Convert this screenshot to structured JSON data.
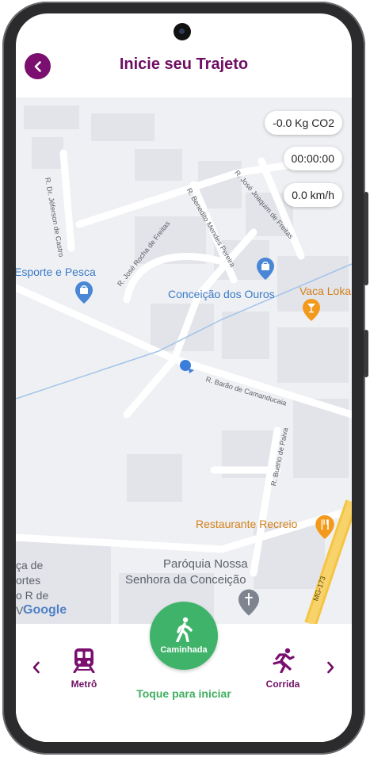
{
  "header": {
    "title": "Inicie seu Trajeto"
  },
  "stats": {
    "co2": "-0.0 Kg CO2",
    "time": "00:00:00",
    "speed": "0.0 km/h"
  },
  "map": {
    "places": {
      "esporte": "Esporte e Pesca",
      "conceicao": "Conceição dos Ouros",
      "vaca": "Vaca Loka",
      "restaurante": "Restaurante Recreio",
      "paroquia_l1": "Paróquia Nossa",
      "paroquia_l2": "Senhora da Conceição",
      "cut_l1": "ça de",
      "cut_l2": "ortes",
      "cut_l3": "o R de",
      "cut_l4": "V"
    },
    "streets": {
      "jeferson": "R. Dr. Jéferson de Castro",
      "jose_joaquim": "R. José Joaquim de Freitas",
      "benedito": "R. Benedito Mendes Pereira",
      "jose_rocha": "R. José Rocha de Freitas",
      "barao": "R. Barão de Camanducaia",
      "bueno": "R. Bueno de Paiva",
      "mg173": "MG-173"
    },
    "google": "Google"
  },
  "bottom": {
    "left_mode": "Metrô",
    "center_mode": "Caminhada",
    "right_mode": "Corrida",
    "hint": "Toque para iniciar"
  },
  "colors": {
    "brand": "#6e0e63",
    "accent_green": "#3fb36a"
  },
  "icons": {
    "back": "chevron-left-icon",
    "metro": "train-icon",
    "walk": "walk-icon",
    "run": "run-icon"
  }
}
